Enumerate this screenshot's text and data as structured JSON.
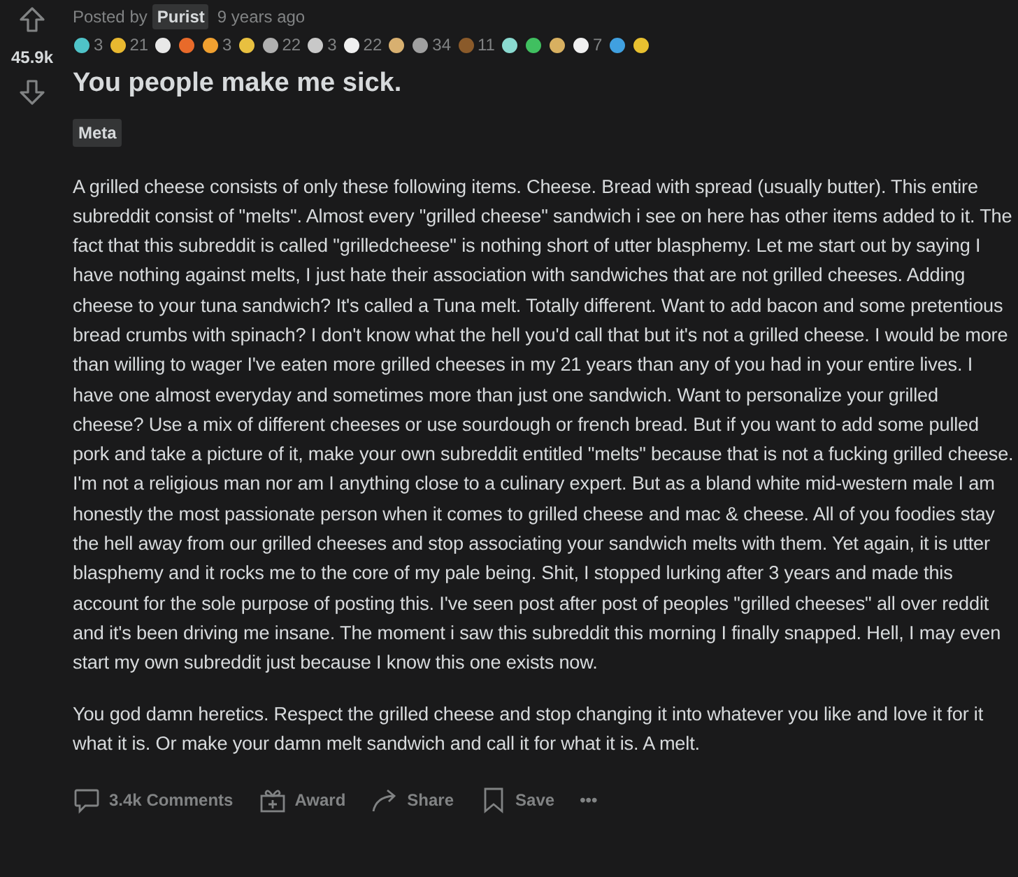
{
  "vote": {
    "score": "45.9k"
  },
  "post": {
    "posted_by_label": "Posted by",
    "author": "Purist",
    "time": "9 years ago",
    "awards": [
      {
        "color": "#4fc3c8",
        "count": "3"
      },
      {
        "color": "#e8b830",
        "count": "21"
      },
      {
        "color": "#e8e8e8"
      },
      {
        "color": "#e86a2a"
      },
      {
        "color": "#f0a030",
        "count": "3"
      },
      {
        "color": "#e8c040"
      },
      {
        "color": "#b0b0b0",
        "count": "22"
      },
      {
        "color": "#c8c8c8",
        "count": "3"
      },
      {
        "color": "#f0f0f0",
        "count": "22"
      },
      {
        "color": "#d8b070"
      },
      {
        "color": "#a0a0a0",
        "count": "34"
      },
      {
        "color": "#8a5a2a",
        "count": "11"
      },
      {
        "color": "#8adad0"
      },
      {
        "color": "#40c060"
      },
      {
        "color": "#d8b060"
      },
      {
        "color": "#f0f0f0",
        "count": "7"
      },
      {
        "color": "#40a0e0"
      },
      {
        "color": "#e8c030"
      }
    ],
    "title": "You people make me sick.",
    "flair": "Meta",
    "paragraphs": [
      "A grilled cheese consists of only these following items. Cheese. Bread with spread (usually butter). This entire subreddit consist of \"melts\". Almost every \"grilled cheese\" sandwich i see on here has other items added to it. The fact that this subreddit is called \"grilledcheese\" is nothing short of utter blasphemy. Let me start out by saying I have nothing against melts, I just hate their association with sandwiches that are not grilled cheeses. Adding cheese to your tuna sandwich? It's called a Tuna melt. Totally different. Want to add bacon and some pretentious bread crumbs with spinach? I don't know what the hell you'd call that but it's not a grilled cheese. I would be more than willing to wager I've eaten more grilled cheeses in my 21 years than any of you had in your entire lives. I have one almost everyday and sometimes more than just one sandwich. Want to personalize your grilled cheese? Use a mix of different cheeses or use sourdough or french bread. But if you want to add some pulled pork and take a picture of it, make your own subreddit entitled \"melts\" because that is not a fucking grilled cheese. I'm not a religious man nor am I anything close to a culinary expert. But as a bland white mid-western male I am honestly the most passionate person when it comes to grilled cheese and mac & cheese. All of you foodies stay the hell away from our grilled cheeses and stop associating your sandwich melts with them. Yet again, it is utter blasphemy and it rocks me to the core of my pale being. Shit, I stopped lurking after 3 years and made this account for the sole purpose of posting this. I've seen post after post of peoples \"grilled cheeses\" all over reddit and it's been driving me insane. The moment i saw this subreddit this morning I finally snapped. Hell, I may even start my own subreddit just because I know this one exists now.",
      "You god damn heretics. Respect the grilled cheese and stop changing it into whatever you like and love it for it what it is. Or make your damn melt sandwich and call it for what it is. A melt."
    ]
  },
  "actions": [
    {
      "kind": "comments",
      "label": "3.4k Comments"
    },
    {
      "kind": "award",
      "label": "Award"
    },
    {
      "kind": "share",
      "label": "Share"
    },
    {
      "kind": "save",
      "label": "Save"
    },
    {
      "kind": "more",
      "label": "•••"
    }
  ]
}
